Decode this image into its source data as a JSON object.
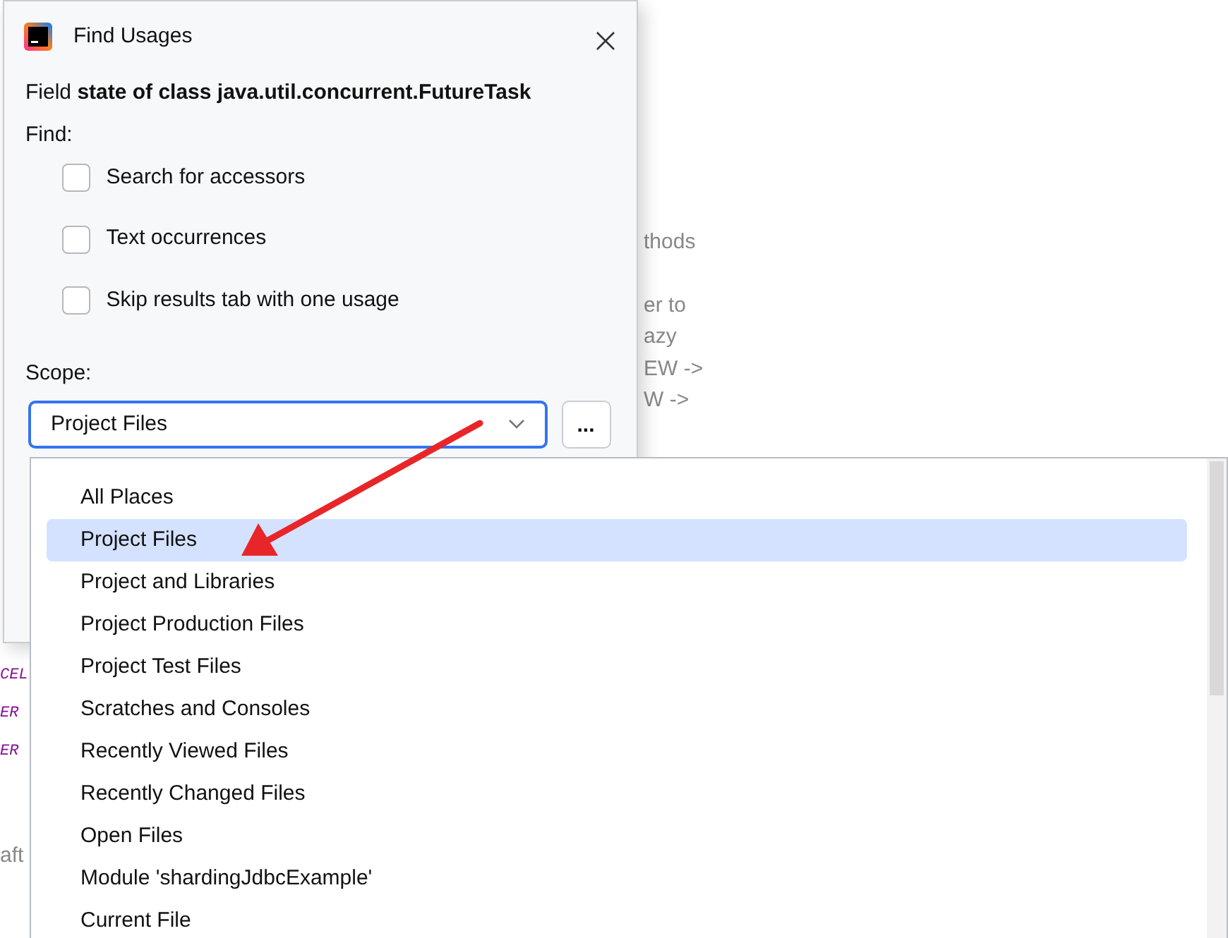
{
  "background_editor": {
    "right_fragments": [
      {
        "text": "thods"
      },
      {
        "text": "er to"
      },
      {
        "text": "azy"
      },
      {
        "text": "EW ->"
      },
      {
        "text": "W ->"
      }
    ],
    "left_fragments": [
      {
        "text": "CEL",
        "kind": "constant"
      },
      {
        "text": "ER",
        "kind": "constant"
      },
      {
        "text": "ER",
        "kind": "constant"
      },
      {
        "text": "aft",
        "kind": "comment"
      }
    ]
  },
  "window": {
    "title": "Find Usages"
  },
  "description": "Field **state of class java.util.concurrent.FutureTask**",
  "find_label": "Find:",
  "options": [
    {
      "label": "Search for accessors",
      "checked": false
    },
    {
      "label": "Text occurrences",
      "checked": false
    },
    {
      "label": "Skip results tab with one usage",
      "checked": false
    }
  ],
  "scope": {
    "label": "Scope:",
    "value": "Project Files",
    "browse_button": "...",
    "expanded": true
  },
  "scope_list": [
    {
      "label": "All Places",
      "selected": false
    },
    {
      "label": "Project Files",
      "selected": true
    },
    {
      "label": "Project and Libraries",
      "selected": false
    },
    {
      "label": "Project Production Files",
      "selected": false
    },
    {
      "label": "Project Test Files",
      "selected": false
    },
    {
      "label": "Scratches and Consoles",
      "selected": false
    },
    {
      "label": "Recently Viewed Files",
      "selected": false
    },
    {
      "label": "Recently Changed Files",
      "selected": false
    },
    {
      "label": "Open Files",
      "selected": false
    },
    {
      "label": "Module 'shardingJdbcExample'",
      "selected": false
    },
    {
      "label": "Current File",
      "selected": false
    }
  ]
}
